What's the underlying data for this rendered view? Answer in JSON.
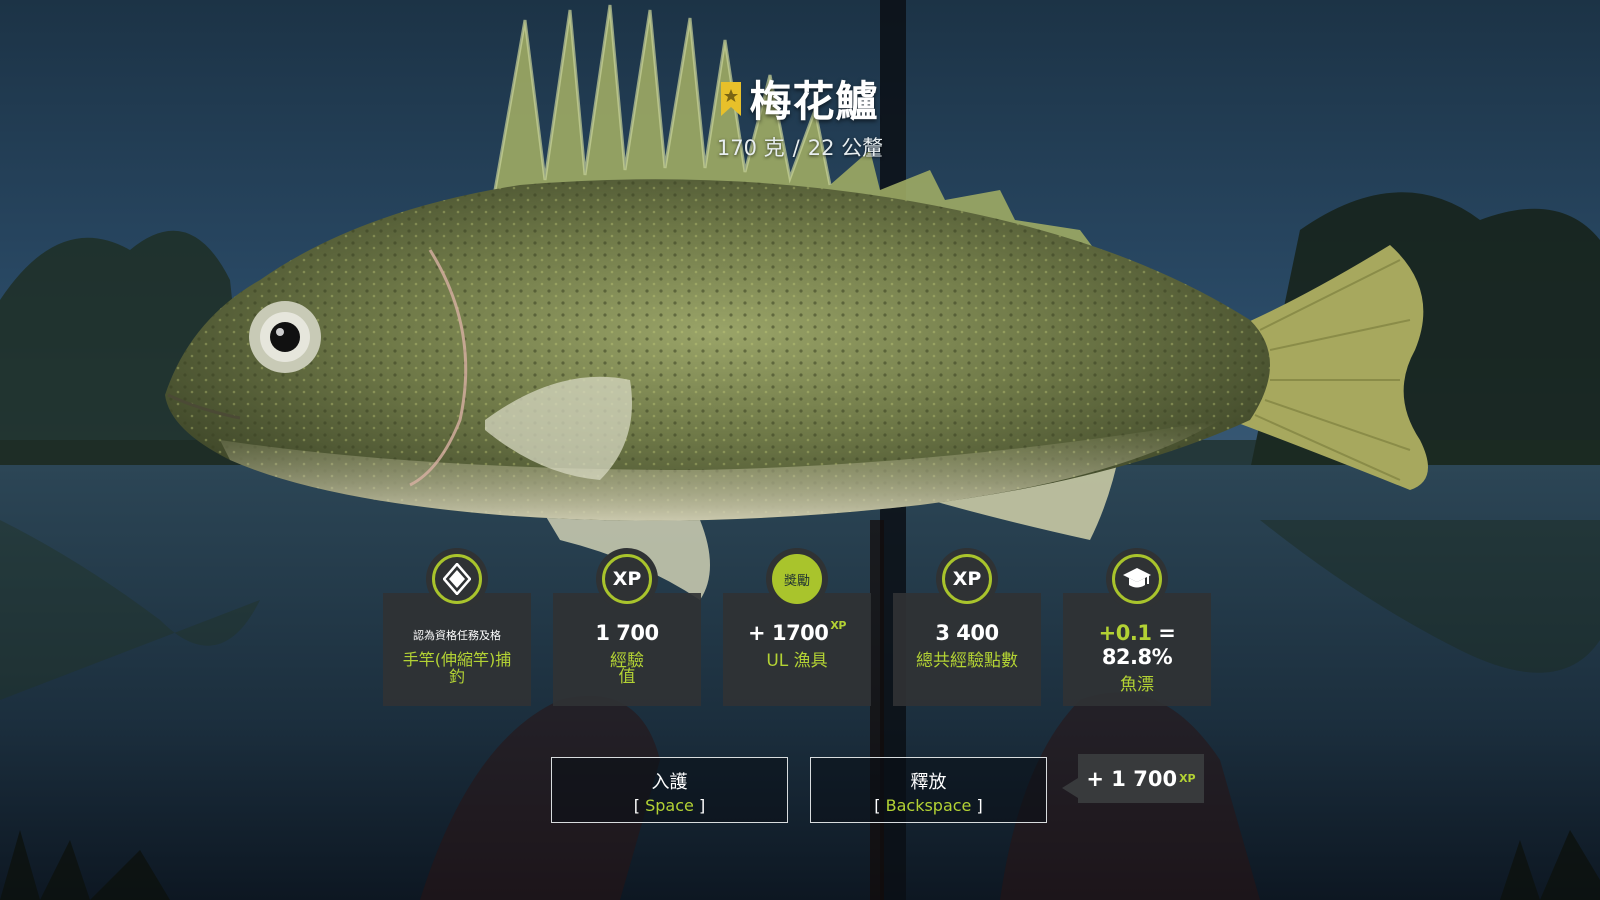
{
  "catch": {
    "species": "梅花鱸",
    "weight": "170 克",
    "separator": "/",
    "length": "22 公釐"
  },
  "cards": [
    {
      "badge": "diamond-icon",
      "small_text": "認為資格任務及格",
      "green_line1": "手竿(伸縮竿)捕",
      "green_line2": "釣"
    },
    {
      "badge_text": "XP",
      "value": "1 700",
      "green_line1": "經驗",
      "green_line2": "值"
    },
    {
      "badge_text": "獎勵",
      "value_plus": "+",
      "value": "1700",
      "value_sup": "XP",
      "green_line1": "UL 漁具"
    },
    {
      "badge_text": "XP",
      "value": "3 400",
      "green_line1": "總共經驗點數"
    },
    {
      "badge": "graduation-cap-icon",
      "value_plus": "+0.1",
      "value": "= 82.8%",
      "green_line1": "魚漂"
    }
  ],
  "buttons": {
    "keep": {
      "label": "入護",
      "key": "Space"
    },
    "release": {
      "label": "釋放",
      "key": "Backspace"
    }
  },
  "xp_tooltip": {
    "value": "+ 1 700",
    "unit": "XP"
  },
  "colors": {
    "accent": "#a9c42c",
    "card_bg": "#303234"
  }
}
